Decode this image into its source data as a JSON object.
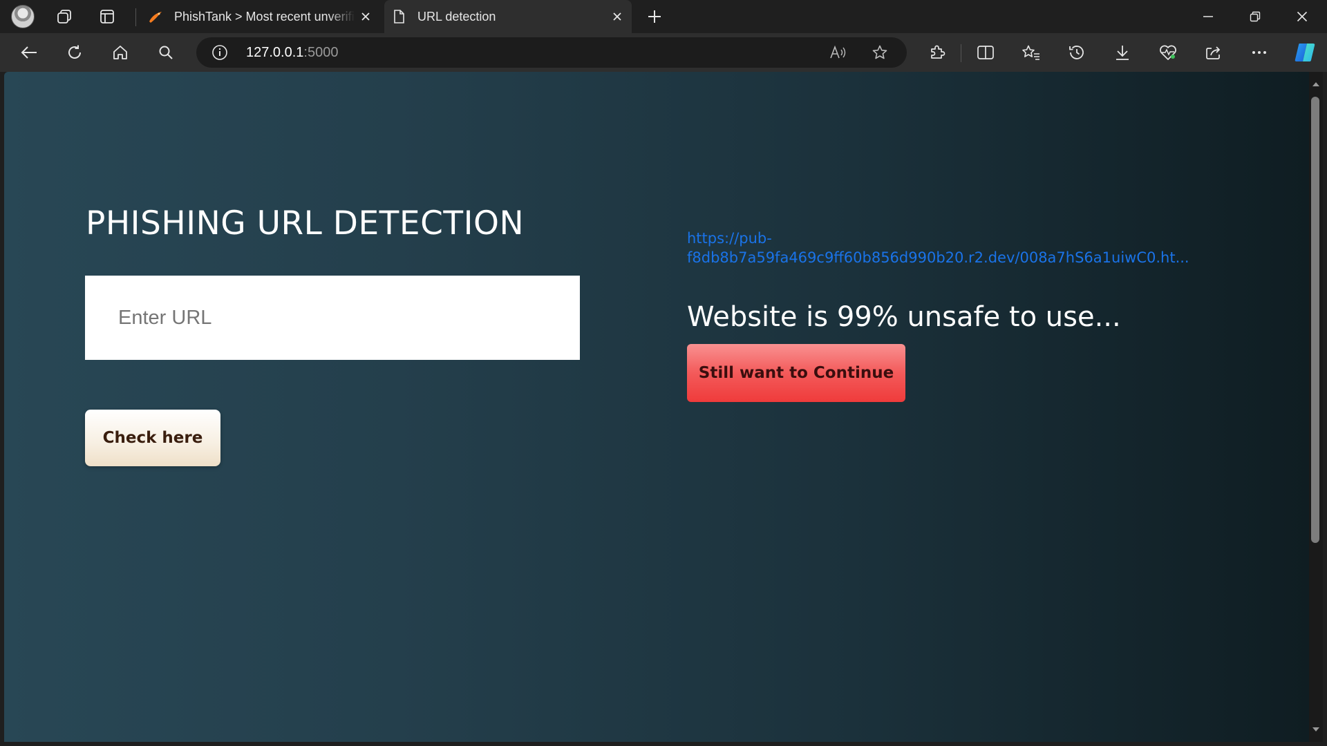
{
  "browser": {
    "tabs": [
      {
        "title": "PhishTank > Most recent unverified phishes",
        "favicon": "phishtank-fish-icon",
        "active": false
      },
      {
        "title": "URL detection",
        "favicon": "page-icon",
        "active": true
      }
    ],
    "address": {
      "host": "127.0.0.1",
      "port": ":5000"
    },
    "colors": {
      "chrome_dark": "#1f1f1f",
      "toolbar": "#2e2e2e",
      "address_bg": "#1c1c1c"
    }
  },
  "page": {
    "heading": "PHISHING URL DETECTION",
    "input_placeholder": "Enter URL",
    "input_value": "",
    "check_button": "Check here",
    "result_url_line1": "https://pub-",
    "result_url_line2": "f8db8b7a59fa469c9ff60b856d990b20.r2.dev/008a7hS6a1uiwC0.ht...",
    "verdict": "Website is 99% unsafe to use...",
    "continue_button": "Still want to Continue",
    "colors": {
      "bg_left": "#284755",
      "bg_right": "#0f1d22",
      "link": "#1a73e8",
      "continue_btn": "#f35a5a",
      "check_btn": "#f7efe2"
    }
  }
}
